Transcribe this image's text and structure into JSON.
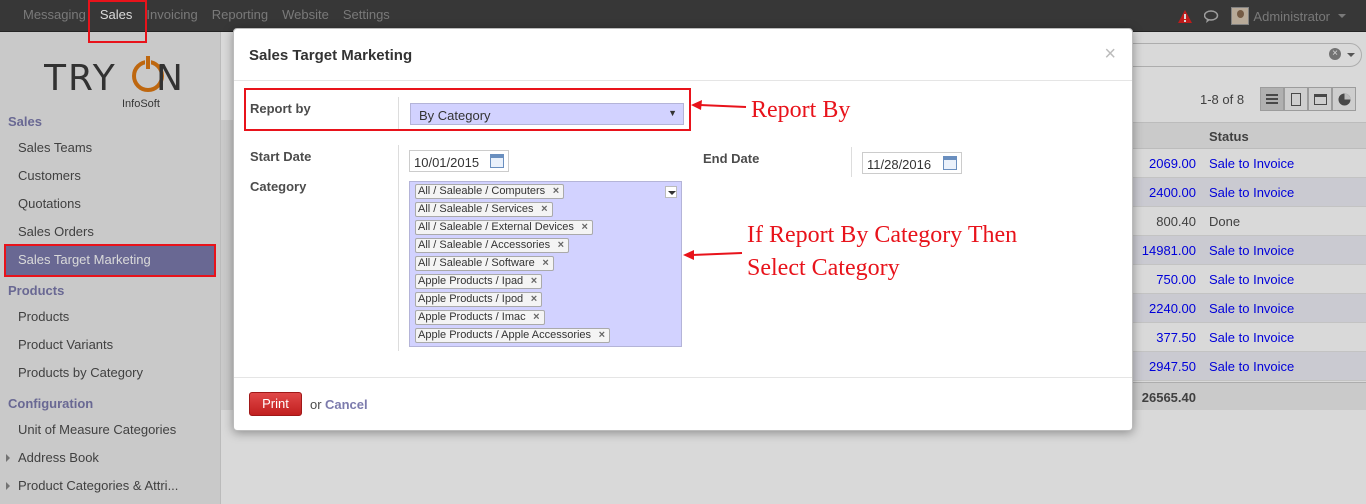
{
  "topbar": {
    "menu": [
      "Messaging",
      "Sales",
      "Invoicing",
      "Reporting",
      "Website",
      "Settings"
    ],
    "active": "Sales",
    "user": "Administrator"
  },
  "logo": {
    "main": "TRYON",
    "sub": "InfoSoft"
  },
  "sidebar": {
    "sections": [
      {
        "title": "Sales",
        "items": [
          "Sales Teams",
          "Customers",
          "Quotations",
          "Sales Orders",
          "Sales Target Marketing"
        ]
      },
      {
        "title": "Products",
        "items": [
          "Products",
          "Product Variants",
          "Products by Category"
        ]
      },
      {
        "title": "Configuration",
        "items": [
          "Unit of Measure Categories",
          "Address Book",
          "Product Categories & Attri..."
        ]
      }
    ],
    "selected": "Sales Target Marketing"
  },
  "list": {
    "pager": "1-8 of 8",
    "status_header": "Status",
    "rows": [
      {
        "amount": "2069.00",
        "status": "Sale to Invoice"
      },
      {
        "amount": "2400.00",
        "status": "Sale to Invoice"
      },
      {
        "amount": "800.40",
        "status": "Done"
      },
      {
        "amount": "14981.00",
        "status": "Sale to Invoice"
      },
      {
        "amount": "750.00",
        "status": "Sale to Invoice"
      },
      {
        "amount": "2240.00",
        "status": "Sale to Invoice"
      },
      {
        "amount": "377.50",
        "status": "Sale to Invoice"
      },
      {
        "amount": "2947.50",
        "status": "Sale to Invoice"
      }
    ],
    "total": "26565.40"
  },
  "modal": {
    "title": "Sales Target Marketing",
    "close": "×",
    "report_by_label": "Report by",
    "report_by_value": "By Category",
    "start_date_label": "Start Date",
    "start_date": "10/01/2015",
    "end_date_label": "End Date",
    "end_date": "11/28/2016",
    "category_label": "Category",
    "categories": [
      "All / Saleable / Computers",
      "All / Saleable / Services",
      "All / Saleable / External Devices",
      "All / Saleable / Accessories",
      "All / Saleable / Software",
      "Apple Products / Ipad",
      "Apple Products / Ipod",
      "Apple Products / Imac",
      "Apple Products / Apple Accessories"
    ],
    "print_label": "Print",
    "or_label": "or",
    "cancel_label": "Cancel"
  },
  "annotations": {
    "report_by": "Report By",
    "category_line1": "If Report By Category Then",
    "category_line2": "Select Category"
  },
  "colors": {
    "accent": "#7c7bad",
    "annotation": "#e8131b",
    "print_button": "#d42e2e",
    "select_bg": "#d2d2ff"
  }
}
